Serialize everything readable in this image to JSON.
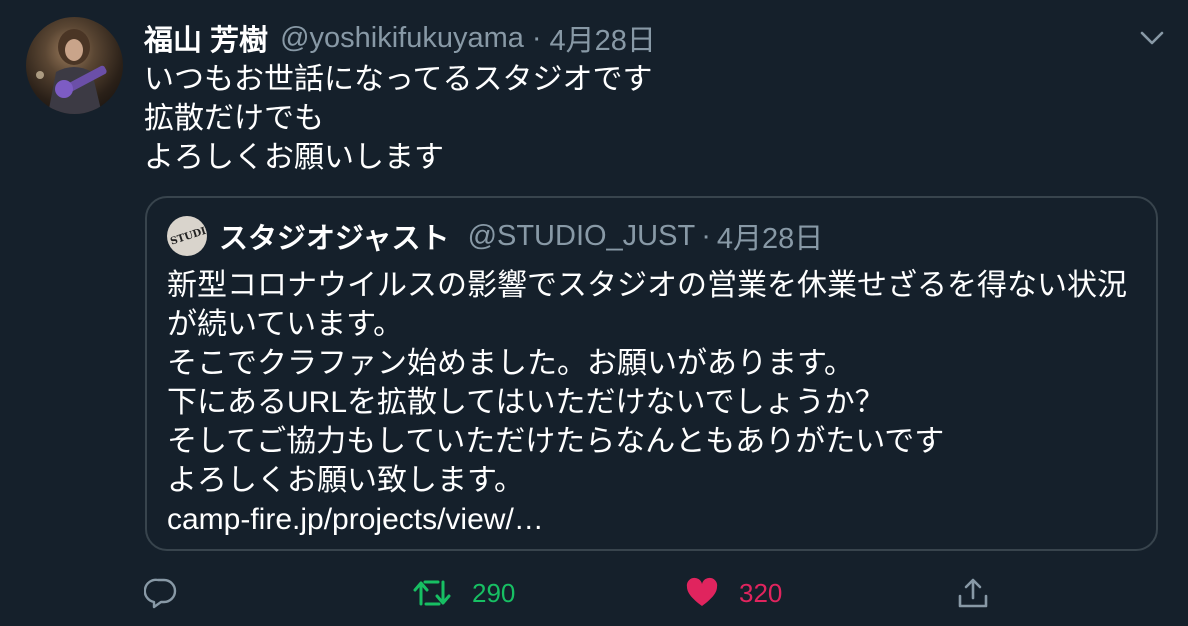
{
  "tweet": {
    "display_name": "福山 芳樹",
    "handle": "@yoshikifukuyama",
    "separator": "·",
    "date": "4月28日",
    "text_lines": [
      "いつもお世話になってるスタジオです",
      "拡散だけでも",
      "よろしくお願いします"
    ]
  },
  "quote": {
    "avatar_text": "STUDIO JUST",
    "display_name": "スタジオジャスト",
    "handle": "@STUDIO_JUST",
    "separator": "·",
    "date": "4月28日",
    "text_lines": [
      "新型コロナウイルスの影響でスタジオの営業を休業せざるを得ない状況",
      "が続いています。",
      "そこでクラファン始めました。お願いがあります。",
      "下にあるURLを拡散してはいただけないでしょうか？",
      "そしてご協力もしていただけたらなんともありがたいです",
      "よろしくお願い致します。",
      "camp-fire.jp/projects/view/…"
    ]
  },
  "actions": {
    "reply_icon": "reply-icon",
    "retweet_icon": "retweet-icon",
    "retweet_count": "290",
    "like_icon": "heart-icon",
    "like_count": "320",
    "share_icon": "share-icon"
  },
  "colors": {
    "background": "#15202b",
    "secondary_text": "#8899a6",
    "border": "#38444d",
    "retweet_green": "#17bf63",
    "like_red": "#e0245e"
  }
}
